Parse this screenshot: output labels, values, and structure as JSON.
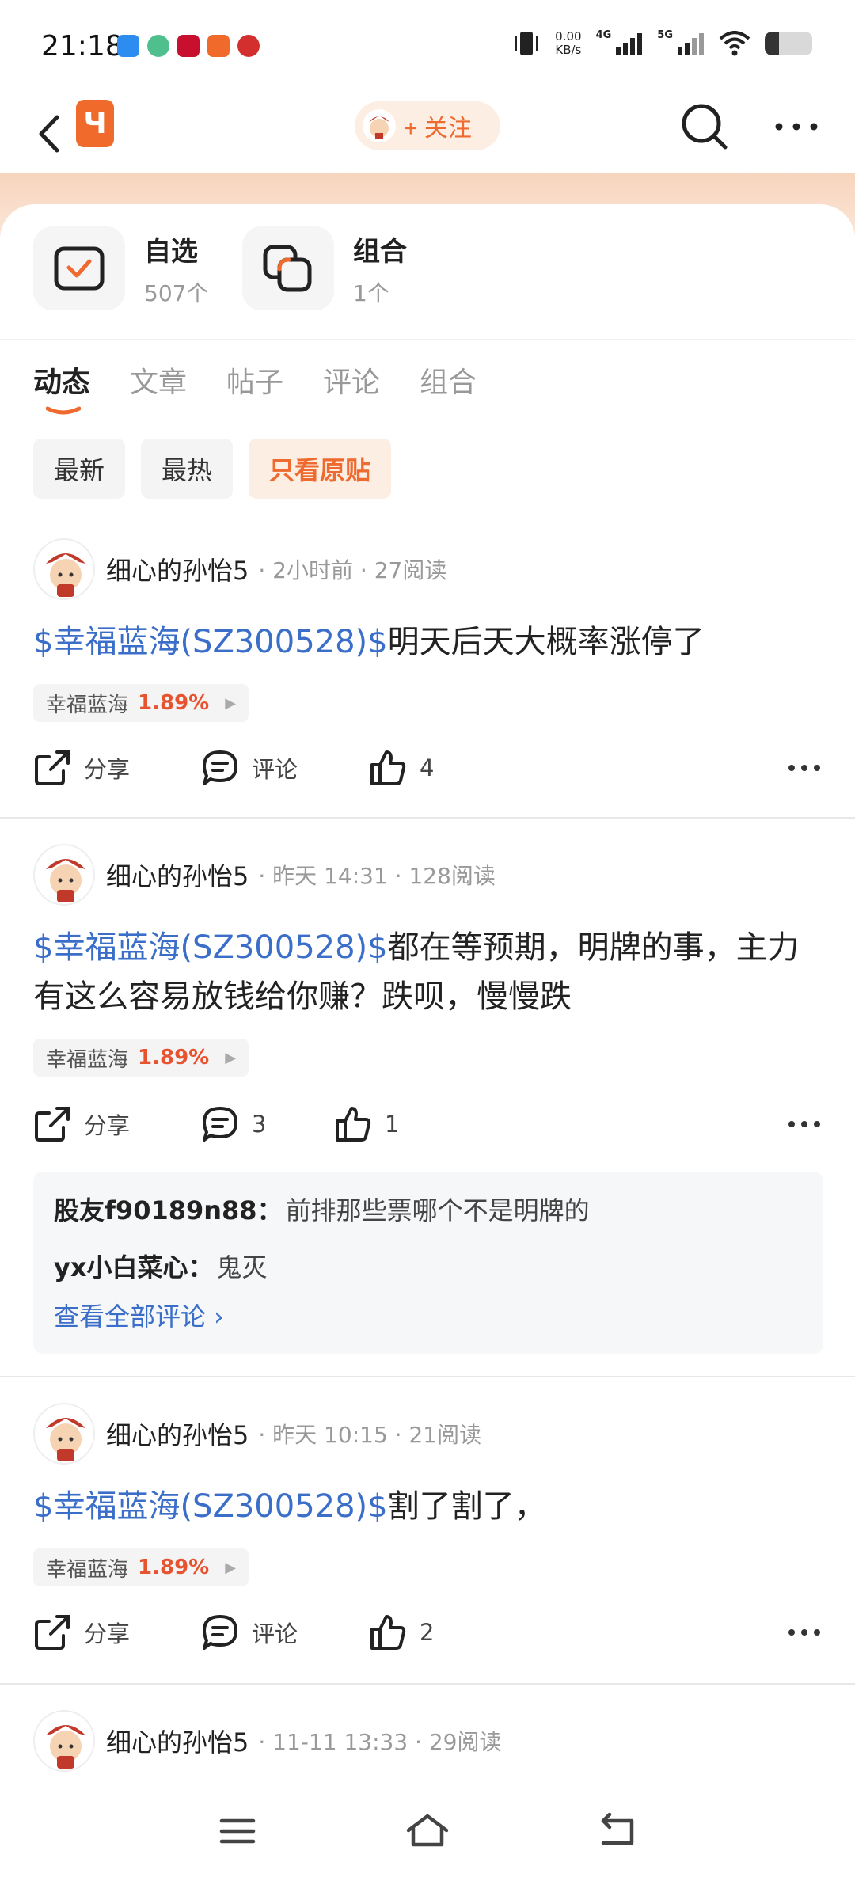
{
  "status": {
    "time": "21:18",
    "net_speed_value": "0.00",
    "net_speed_unit": "KB/s",
    "sig1_tag": "4G",
    "sig2_tag": "5G",
    "battery_level": 0.3,
    "app_icons": [
      "app-icon-blue",
      "app-icon-color",
      "app-icon-red",
      "app-icon-telegram",
      "app-icon-red2"
    ]
  },
  "nav": {
    "logo_text": "Ч",
    "follow_label": "+ 关注"
  },
  "portfolio": {
    "watchlist_title": "自选",
    "watchlist_count": "507个",
    "combo_title": "组合",
    "combo_count": "1个"
  },
  "tabs": [
    "动态",
    "文章",
    "帖子",
    "评论",
    "组合"
  ],
  "filters": [
    "最新",
    "最热",
    "只看原贴"
  ],
  "posts": [
    {
      "author": "细心的孙怡5",
      "meta": "· 2小时前 · 27阅读",
      "stock_link": "$幸福蓝海(SZ300528)$",
      "text": "明天后天大概率涨停了",
      "tag_name": "幸福蓝海",
      "tag_pct": "1.89%",
      "share": "分享",
      "comment": "评论",
      "likes": "4"
    },
    {
      "author": "细心的孙怡5",
      "meta": "· 昨天 14:31 · 128阅读",
      "stock_link": "$幸福蓝海(SZ300528)$",
      "text": "都在等预期，明牌的事，主力有这么容易放钱给你赚？跌呗，慢慢跌",
      "tag_name": "幸福蓝海",
      "tag_pct": "1.89%",
      "share": "分享",
      "comment": "3",
      "likes": "1",
      "comments": [
        {
          "user": "股友f90189n88：",
          "body": "前排那些票哪个不是明牌的"
        },
        {
          "user": "yx小白菜心：",
          "body": "鬼灭"
        }
      ],
      "view_all": "查看全部评论 ›"
    },
    {
      "author": "细心的孙怡5",
      "meta": "· 昨天 10:15 · 21阅读",
      "stock_link": "$幸福蓝海(SZ300528)$",
      "text": "割了割了，",
      "tag_name": "幸福蓝海",
      "tag_pct": "1.89%",
      "share": "分享",
      "comment": "评论",
      "likes": "2"
    },
    {
      "author": "细心的孙怡5",
      "meta": "· 11-11 13:33 · 29阅读"
    }
  ],
  "colors": {
    "accent": "#ee6a2f",
    "link": "#3a6ec8",
    "up": "#e8532f"
  }
}
